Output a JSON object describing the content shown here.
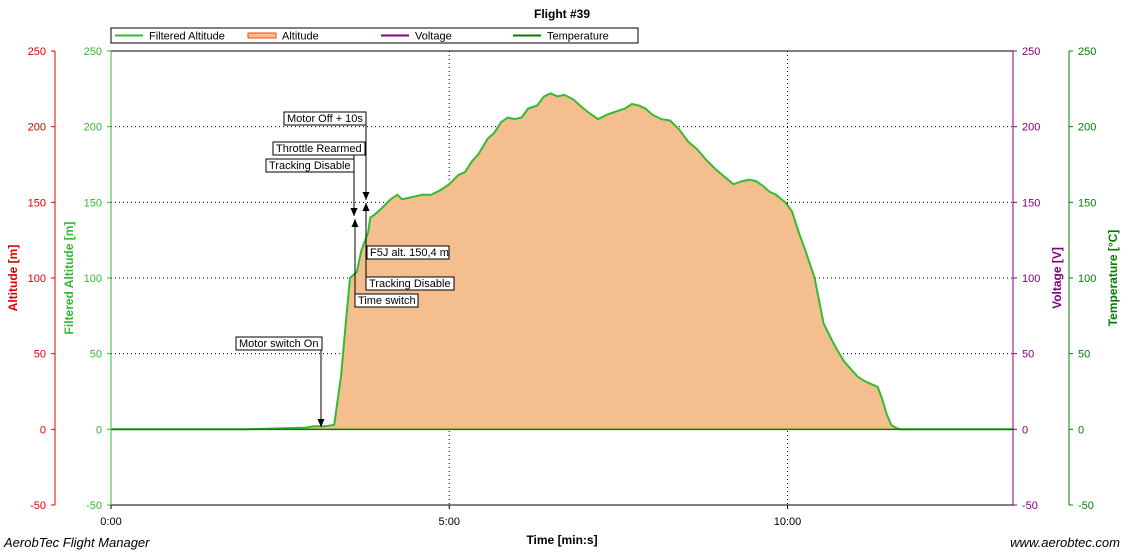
{
  "chart_data": {
    "type": "area",
    "title": "Flight #39",
    "xlabel": "Time [min:s]",
    "x_unit": "seconds",
    "x_ticks": [
      {
        "value": 0,
        "label": "0:00"
      },
      {
        "value": 300,
        "label": "5:00"
      },
      {
        "value": 600,
        "label": "10:00"
      }
    ],
    "xlim": [
      0,
      800
    ],
    "grid": true,
    "legend_position": "top",
    "axes": [
      {
        "id": "altitude",
        "label": "Altitude [m]",
        "side": "left-outer",
        "color": "#dd0000",
        "ylim": [
          -50,
          250
        ]
      },
      {
        "id": "filtered",
        "label": "Filtered Altitude [m]",
        "side": "left-inner",
        "color": "#33bb33",
        "ylim": [
          -50,
          250
        ]
      },
      {
        "id": "voltage",
        "label": "Voltage [V]",
        "side": "right-inner",
        "color": "#800080",
        "ylim": [
          -50,
          250
        ]
      },
      {
        "id": "temperature",
        "label": "Temperature [°C]",
        "side": "right-outer",
        "color": "#008000",
        "ylim": [
          -50,
          250
        ]
      }
    ],
    "y_ticks": [
      -50,
      0,
      50,
      100,
      150,
      200,
      250
    ],
    "series": [
      {
        "name": "Filtered Altitude",
        "color": "#33bb33",
        "style": "line",
        "axis": "filtered"
      },
      {
        "name": "Altitude",
        "color": "#f5be8f",
        "edge_color": "#ff4400",
        "style": "area",
        "axis": "altitude"
      },
      {
        "name": "Voltage",
        "color": "#800080",
        "style": "line",
        "axis": "voltage"
      },
      {
        "name": "Temperature",
        "color": "#008000",
        "style": "line",
        "axis": "temperature"
      }
    ],
    "altitude_profile": {
      "x": [
        0,
        60,
        120,
        168,
        172,
        180,
        190,
        198,
        204,
        208,
        212,
        218,
        222,
        228,
        230,
        234,
        240,
        244,
        248,
        250,
        254,
        258,
        264,
        270,
        276,
        284,
        292,
        300,
        308,
        314,
        320,
        326,
        334,
        340,
        346,
        352,
        358,
        364,
        370,
        378,
        384,
        390,
        396,
        402,
        410,
        416,
        424,
        432,
        440,
        448,
        456,
        462,
        468,
        474,
        480,
        488,
        496,
        504,
        512,
        520,
        528,
        536,
        544,
        552,
        556,
        560,
        566,
        572,
        578,
        584,
        590,
        598,
        604,
        610,
        616,
        624,
        632,
        640,
        646,
        650,
        656,
        662,
        668,
        674,
        680,
        684,
        688,
        692,
        696,
        700,
        704,
        708,
        712,
        716,
        720,
        724,
        728,
        732,
        736,
        738,
        740,
        742,
        745,
        750,
        760,
        800
      ],
      "y": [
        0,
        0,
        0,
        1,
        1,
        2,
        2,
        3,
        35,
        68,
        100,
        104,
        118,
        130,
        140,
        142,
        146,
        149,
        152,
        153,
        155,
        152,
        153,
        154,
        155,
        155,
        158,
        162,
        168,
        170,
        177,
        182,
        192,
        196,
        203,
        206,
        205,
        206,
        212,
        214,
        220,
        222,
        220,
        221,
        218,
        214,
        209,
        205,
        208,
        210,
        212,
        215,
        214,
        212,
        208,
        205,
        204,
        198,
        190,
        185,
        178,
        172,
        167,
        162,
        163,
        164,
        165,
        164,
        161,
        157,
        155,
        150,
        144,
        130,
        118,
        100,
        70,
        58,
        50,
        45,
        40,
        35,
        32,
        30,
        28,
        20,
        10,
        3,
        1,
        0,
        0,
        0,
        0,
        0,
        0,
        0,
        0,
        0,
        0,
        0,
        0,
        0,
        0,
        0,
        0,
        0
      ]
    },
    "annotations": [
      {
        "label": "Motor switch On",
        "x": 188,
        "y": 2,
        "arrow": "down"
      },
      {
        "label": "Tracking Disable",
        "x": 217,
        "y": 147,
        "arrow": "down"
      },
      {
        "label": "Throttle Rearmed",
        "x": 217,
        "y": 147,
        "arrow": "down"
      },
      {
        "label": "Motor Off + 10s",
        "x": 227,
        "y": 152,
        "arrow": "down"
      },
      {
        "label": "Time switch",
        "x": 217,
        "y": 138,
        "arrow": "up"
      },
      {
        "label": "Tracking Disable",
        "x": 227,
        "y": 150,
        "arrow": "up"
      },
      {
        "label": "F5J alt. 150,4 m",
        "x": 227,
        "y": 150,
        "arrow": "up"
      }
    ]
  },
  "footer": {
    "left": "AerobTec Flight Manager",
    "right": "www.aerobtec.com"
  }
}
